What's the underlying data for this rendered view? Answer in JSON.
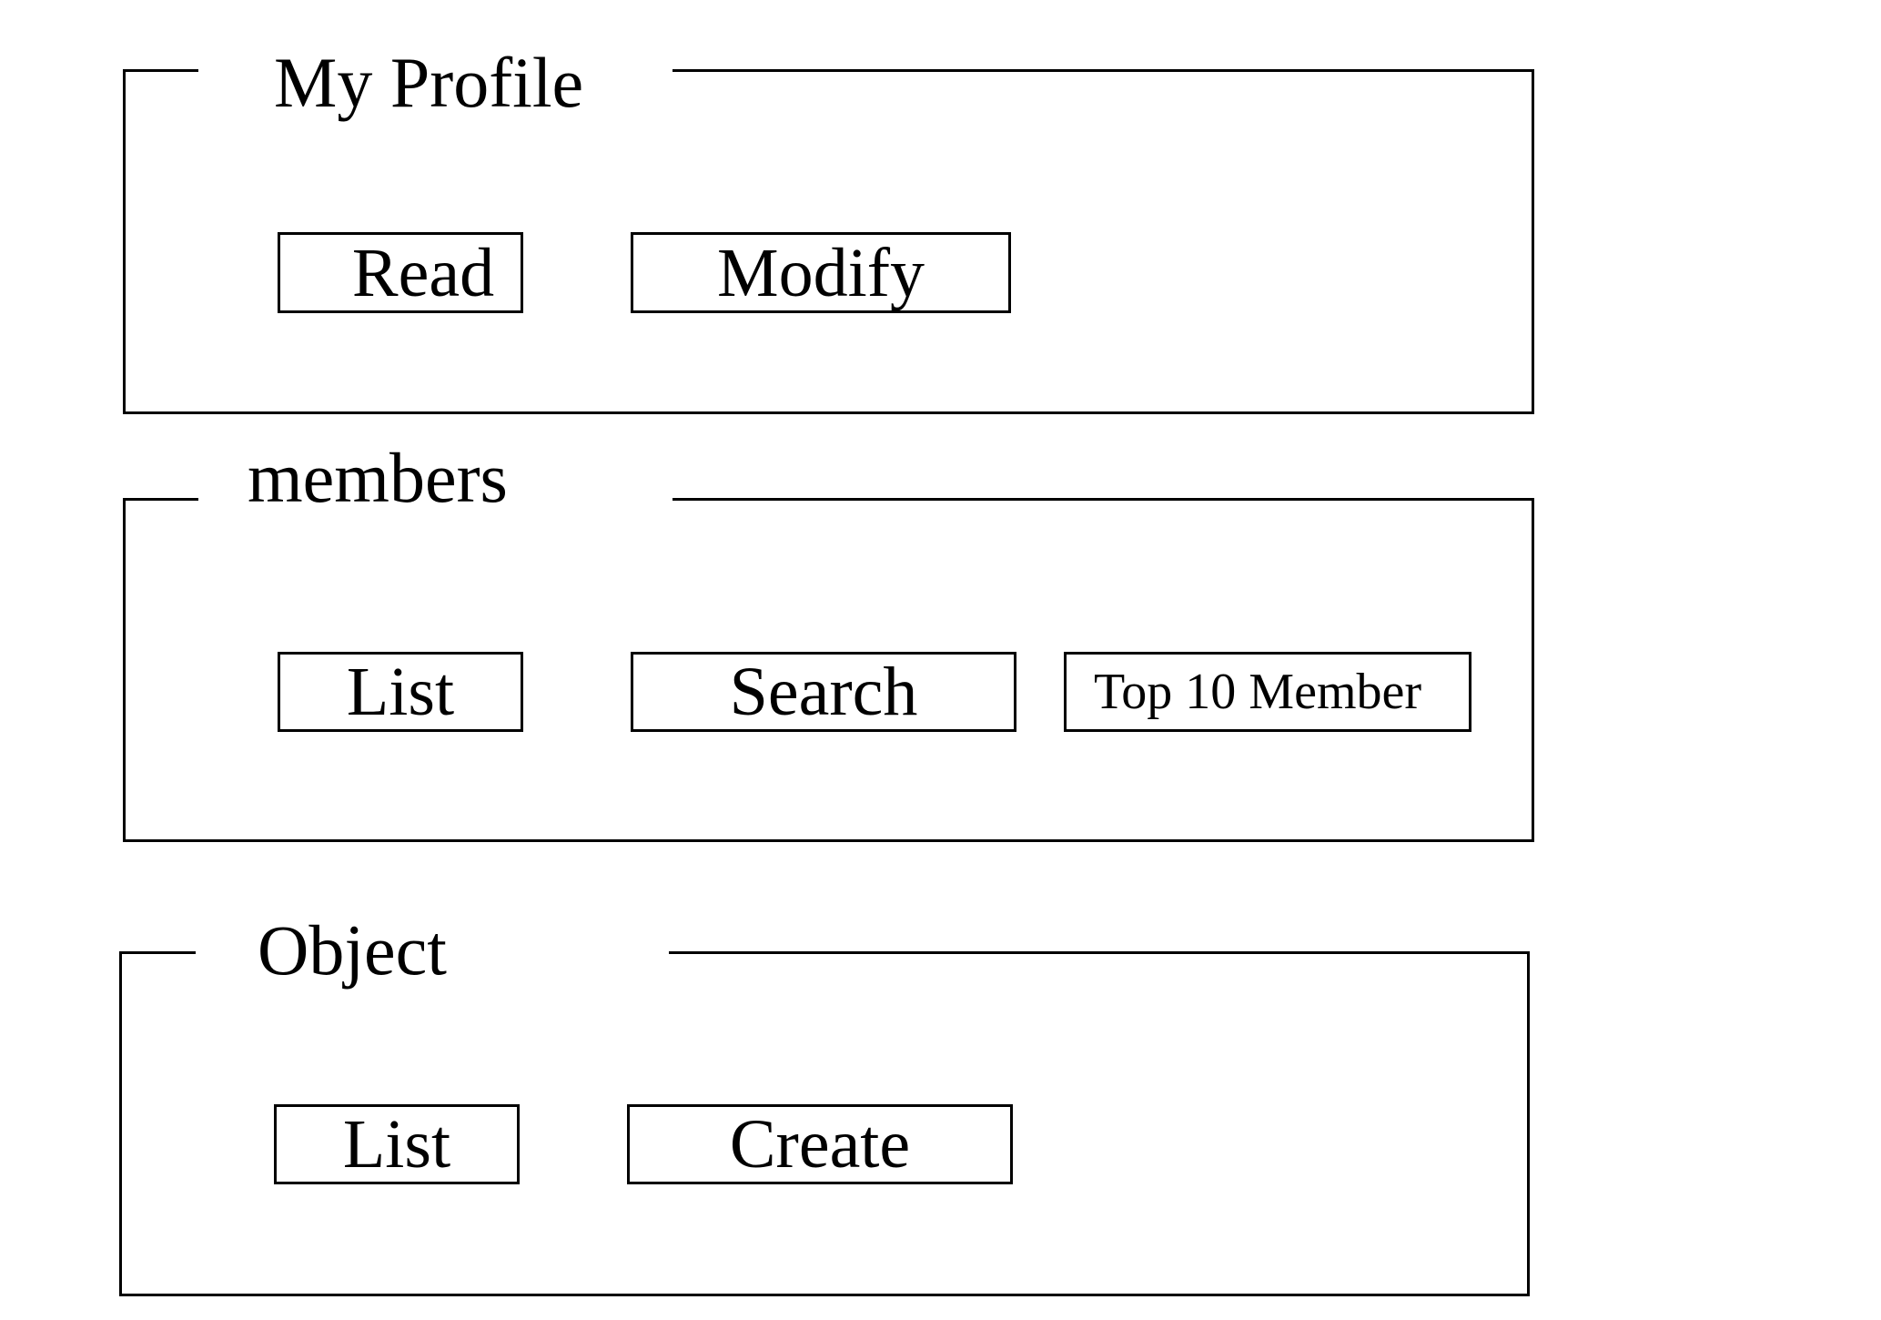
{
  "sections": [
    {
      "title": "My Profile",
      "buttons": [
        "Read",
        "Modify"
      ]
    },
    {
      "title": "members",
      "buttons": [
        "List",
        "Search",
        "Top 10 Member"
      ]
    },
    {
      "title": "Object",
      "buttons": [
        "List",
        "Create"
      ]
    }
  ]
}
